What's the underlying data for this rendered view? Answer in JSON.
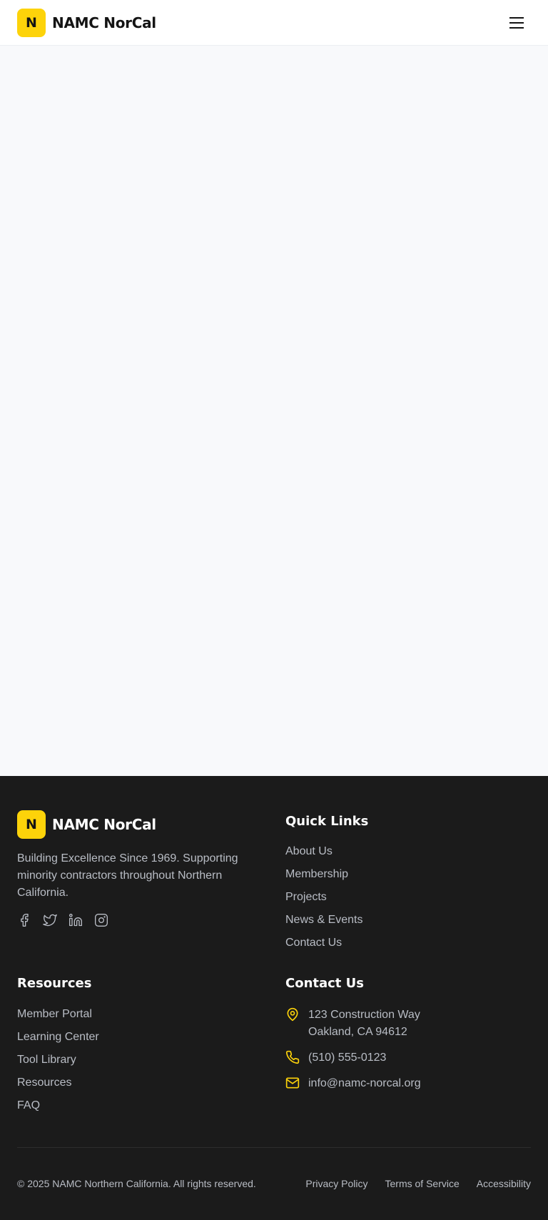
{
  "header": {
    "logo_letter": "N",
    "brand_name": "NAMC NorCal",
    "menu_icon": "hamburger-menu-icon"
  },
  "footer": {
    "logo_letter": "N",
    "brand_name": "NAMC NorCal",
    "description": "Building Excellence Since 1969. Supporting minority contractors throughout Northern California.",
    "socials": [
      "facebook-icon",
      "twitter-icon",
      "linkedin-icon",
      "instagram-icon"
    ],
    "quick_links": {
      "title": "Quick Links",
      "items": [
        "About Us",
        "Membership",
        "Projects",
        "News & Events",
        "Contact Us"
      ]
    },
    "resources": {
      "title": "Resources",
      "items": [
        "Member Portal",
        "Learning Center",
        "Tool Library",
        "Resources",
        "FAQ"
      ]
    },
    "contact": {
      "title": "Contact Us",
      "address_line1": "123 Construction Way",
      "address_line2": "Oakland, CA 94612",
      "phone": "(510) 555-0123",
      "email": "info@namc-norcal.org"
    },
    "copyright": "© 2025 NAMC Northern California. All rights reserved.",
    "legal": [
      "Privacy Policy",
      "Terms of Service",
      "Accessibility"
    ]
  },
  "colors": {
    "accent": "#fdd30a",
    "footer_bg": "#1b1b1b",
    "page_bg": "#f8f9fb",
    "muted_text": "#b9bdc5"
  }
}
